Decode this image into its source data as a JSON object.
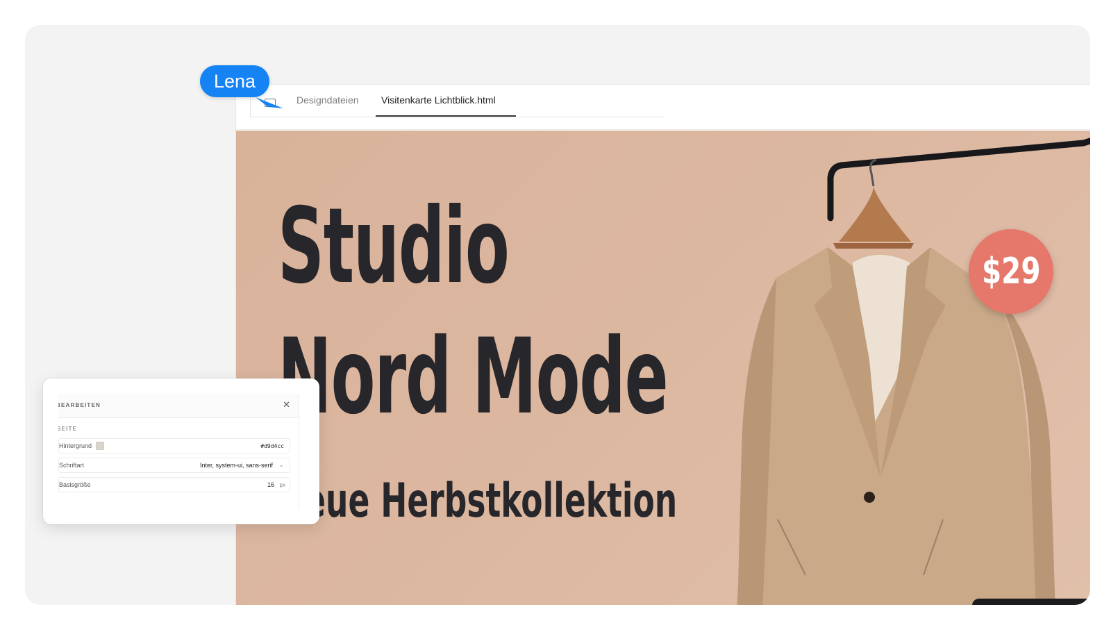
{
  "tabs": {
    "inactive_label": "Designdateien",
    "active_label": "Visitenkarte Lichtblick.html"
  },
  "canvas": {
    "background_color": "#d9b29a",
    "headline_line1": "Studio",
    "headline_line2": "Nord Mode",
    "subline": "Neue Herbstkollektion",
    "price": "$29",
    "price_badge_color": "#e6786b",
    "image": "coat-on-hanger"
  },
  "collaborator": {
    "name": "Lena",
    "color": "#1683f5"
  },
  "properties_panel": {
    "title": "BEARBEITEN",
    "close_icon": "close-icon",
    "section": "SEITE",
    "rows": [
      {
        "label": "Hintergrund",
        "value": "#d9d4cc",
        "swatch_color": "#d9d4cc"
      },
      {
        "label": "Schriftart",
        "value": "Inter, system-ui, sans-serif"
      },
      {
        "label": "Basisgröße",
        "value": "16",
        "unit": "px"
      }
    ]
  }
}
